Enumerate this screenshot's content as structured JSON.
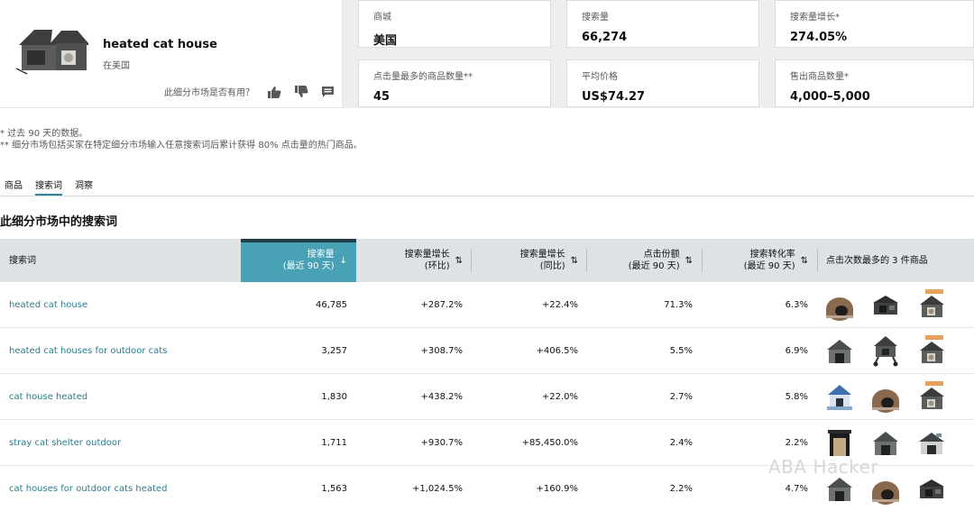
{
  "product": {
    "title": "heated cat house",
    "subtitle": "在美国",
    "feedback_question": "此细分市场是否有用？"
  },
  "stats": [
    {
      "label": "商城",
      "value": "美国"
    },
    {
      "label": "搜索量",
      "value": "66,274"
    },
    {
      "label": "搜索量增长*",
      "value": "274.05%"
    },
    {
      "label": "点击量最多的商品数量**",
      "value": "45"
    },
    {
      "label": "平均价格",
      "value": "US$74.27"
    },
    {
      "label": "售出商品数量*",
      "value": "4,000–5,000"
    }
  ],
  "notes": [
    "* 过去 90 天的数据。",
    "** 细分市场包括买家在特定细分市场输入任意搜索词后累计获得 80% 点击量的热门商品。"
  ],
  "tabs": [
    "商品",
    "搜索词",
    "洞察"
  ],
  "active_tab": "搜索词",
  "section_title": "此细分市场中的搜索词",
  "columns": [
    {
      "line1": "搜索词",
      "line2": ""
    },
    {
      "line1": "搜索量",
      "line2": "(最近 90 天)",
      "sort": "↓"
    },
    {
      "line1": "搜索量增长",
      "line2": "(环比)",
      "sort": "⇅"
    },
    {
      "line1": "搜索量增长",
      "line2": "(同比)",
      "sort": "⇅"
    },
    {
      "line1": "点击份额",
      "line2": "(最近 90 天)",
      "sort": "⇅"
    },
    {
      "line1": "搜索转化率",
      "line2": "(最近 90 天)",
      "sort": "⇅"
    },
    {
      "line1": "点击次数最多的 3 件商品",
      "line2": ""
    }
  ],
  "rows": [
    {
      "term": "heated cat house",
      "volume": "46,785",
      "growth_mom": "+287.2%",
      "growth_yoy": "+22.4%",
      "click_share": "71.3%",
      "conversion": "6.3%",
      "products": [
        "dome-house-icon",
        "flat-house-icon",
        "heated-house-icon"
      ]
    },
    {
      "term": "heated cat houses for outdoor cats",
      "volume": "3,257",
      "growth_mom": "+308.7%",
      "growth_yoy": "+406.5%",
      "click_share": "5.5%",
      "conversion": "6.9%",
      "products": [
        "gray-house-icon",
        "elevated-house-icon",
        "heated-house-icon"
      ]
    },
    {
      "term": "cat house heated",
      "volume": "1,830",
      "growth_mom": "+438.2%",
      "growth_yoy": "+22.0%",
      "click_share": "2.7%",
      "conversion": "5.8%",
      "products": [
        "blue-house-icon",
        "dome-house-icon",
        "heated-house-icon"
      ]
    },
    {
      "term": "stray cat shelter outdoor",
      "volume": "1,711",
      "growth_mom": "+930.7%",
      "growth_yoy": "+85,450.0%",
      "click_share": "2.4%",
      "conversion": "2.2%",
      "products": [
        "wooden-shelter-icon",
        "gray-house-icon",
        "insulated-house-icon"
      ]
    },
    {
      "term": "cat houses for outdoor cats heated",
      "volume": "1,563",
      "growth_mom": "+1,024.5%",
      "growth_yoy": "+160.9%",
      "click_share": "2.2%",
      "conversion": "4.7%",
      "products": [
        "gray-house-icon",
        "dome-house-icon",
        "flat-house-icon"
      ]
    }
  ],
  "watermark": "ABA Hacker"
}
